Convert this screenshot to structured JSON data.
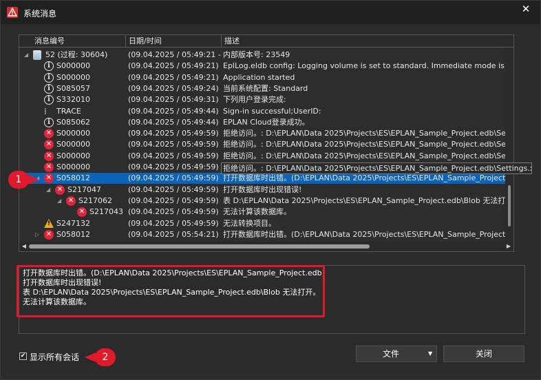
{
  "window": {
    "title": "系统消息",
    "close_glyph": "✕"
  },
  "grid": {
    "columns": [
      "消息编号",
      "日期/时间",
      "描述"
    ],
    "rows": [
      {
        "id": "52 (过程: 30604)",
        "date": "(09.04.2025 / 05:49:21 - ...",
        "desc": "内部版本号: 23549",
        "icon": "database-icon",
        "indent": 0,
        "tree": "◢"
      },
      {
        "id": "S000000",
        "date": "(09.04.2025 / 05:49:21)",
        "desc": "EplLog.eldb config: Logging volume is set to standard. Immediate mode is inact...",
        "icon": "info-icon",
        "indent": 1,
        "tree": ""
      },
      {
        "id": "S000000",
        "date": "(09.04.2025 / 05:49:21)",
        "desc": "Application started",
        "icon": "info-icon",
        "indent": 1,
        "tree": ""
      },
      {
        "id": "S085057",
        "date": "(09.04.2025 / 05:49:24)",
        "desc": "当前系统配置: Standard",
        "icon": "info-icon",
        "indent": 1,
        "tree": ""
      },
      {
        "id": "S332010",
        "date": "(09.04.2025 / 05:49:31)",
        "desc": "下列用户登录完成: ",
        "icon": "info-icon",
        "indent": 1,
        "tree": ""
      },
      {
        "id": "TRACE",
        "date": "(09.04.2025 / 05:49:44)",
        "desc": "Sign-in successful;UserID: ",
        "icon": "trace-icon",
        "indent": 1,
        "tree": ""
      },
      {
        "id": "S085062",
        "date": "(09.04.2025 / 05:49:44)",
        "desc": "EPLAN Cloud登录成功。",
        "icon": "info-icon",
        "indent": 1,
        "tree": ""
      },
      {
        "id": "S000000",
        "date": "(09.04.2025 / 05:49:59)",
        "desc": "拒绝访问。: D:\\EPLAN\\Data 2025\\Projects\\ES\\EPLAN_Sample_Project.edb\\Setti...",
        "icon": "error-icon",
        "indent": 1,
        "tree": ""
      },
      {
        "id": "S000000",
        "date": "(09.04.2025 / 05:49:59)",
        "desc": "拒绝访问。: D:\\EPLAN\\Data 2025\\Projects\\ES\\EPLAN_Sample_Project.edb\\Setti...",
        "icon": "error-icon",
        "indent": 1,
        "tree": ""
      },
      {
        "id": "S000000",
        "date": "(09.04.2025 / 05:49:59)",
        "desc": "拒绝访问。: D:\\EPLAN\\Data 2025\\Projects\\ES\\EPLAN_Sample_Project.edb\\Setti...",
        "icon": "error-icon",
        "indent": 1,
        "tree": ""
      },
      {
        "id": "S000000",
        "date": "(09.04.2025 / 05:49:59)",
        "desc": "拒绝访问。: D:\\EPLAN\\Data 2025\\Projects\\ES\\EPLAN_Sample_Project.edb\\Setti...",
        "icon": "error-icon",
        "indent": 1,
        "tree": ""
      },
      {
        "id": "S058012",
        "date": "(09.04.2025 / 05:49:59)",
        "desc": "打开数据库时出错。(D:\\EPLAN\\Data 2025\\Projects\\ES\\EPLAN_Sample_Project....",
        "icon": "error-icon",
        "indent": 1,
        "tree": "◢",
        "selected": true
      },
      {
        "id": "S217047",
        "date": "(09.04.2025 / 05:49:59)",
        "desc": "打开数据库时出现错误!",
        "icon": "error-icon",
        "indent": 2,
        "tree": "◢"
      },
      {
        "id": "S217062",
        "date": "(09.04.2025 / 05:49:59)",
        "desc": "表 D:\\EPLAN\\Data 2025\\Projects\\ES\\EPLAN_Sample_Project.edb\\Blob 无法打开...",
        "icon": "error-icon",
        "indent": 3,
        "tree": "◢"
      },
      {
        "id": "S217043",
        "date": "(09.04.2025 / 05:49:59)",
        "desc": "无法计算该数据库。",
        "icon": "error-icon",
        "indent": 4,
        "tree": ""
      },
      {
        "id": "S247132",
        "date": "(09.04.2025 / 05:49:59)",
        "desc": "无法转换项目。",
        "icon": "warning-icon",
        "indent": 1,
        "tree": ""
      },
      {
        "id": "S058012",
        "date": "(09.04.2025 / 05:54:21)",
        "desc": "打开数据库时出错。(D:\\EPLAN\\Data 2025\\Projects\\ES\\EPLAN_Sample_Project....",
        "icon": "error-icon",
        "indent": 1,
        "tree": "▷"
      }
    ]
  },
  "tooltip": "拒绝访问。: D:\\EPLAN\\Data 2025\\Projects\\ES\\EPLAN_Sample_Project.edb\\Settings.xdb",
  "detail": {
    "lines": [
      "打开数据库时出错。(D:\\EPLAN\\Data 2025\\Projects\\ES\\EPLAN_Sample_Project.edb)",
      "打开数据库时出现错误!",
      "表 D:\\EPLAN\\Data 2025\\Projects\\ES\\EPLAN_Sample_Project.edb\\Blob 无法打开。",
      "无法计算该数据库。"
    ]
  },
  "callouts": {
    "one": "1",
    "two": "2"
  },
  "footer": {
    "show_all_sessions_label": "显示所有会话",
    "show_all_sessions_checked": true,
    "file_button": "文件",
    "close_button": "关闭"
  },
  "colors": {
    "accent_selected": "#0b64b8",
    "error": "#e0253a",
    "warning": "#f0a81c",
    "highlight": "#e0192b"
  }
}
